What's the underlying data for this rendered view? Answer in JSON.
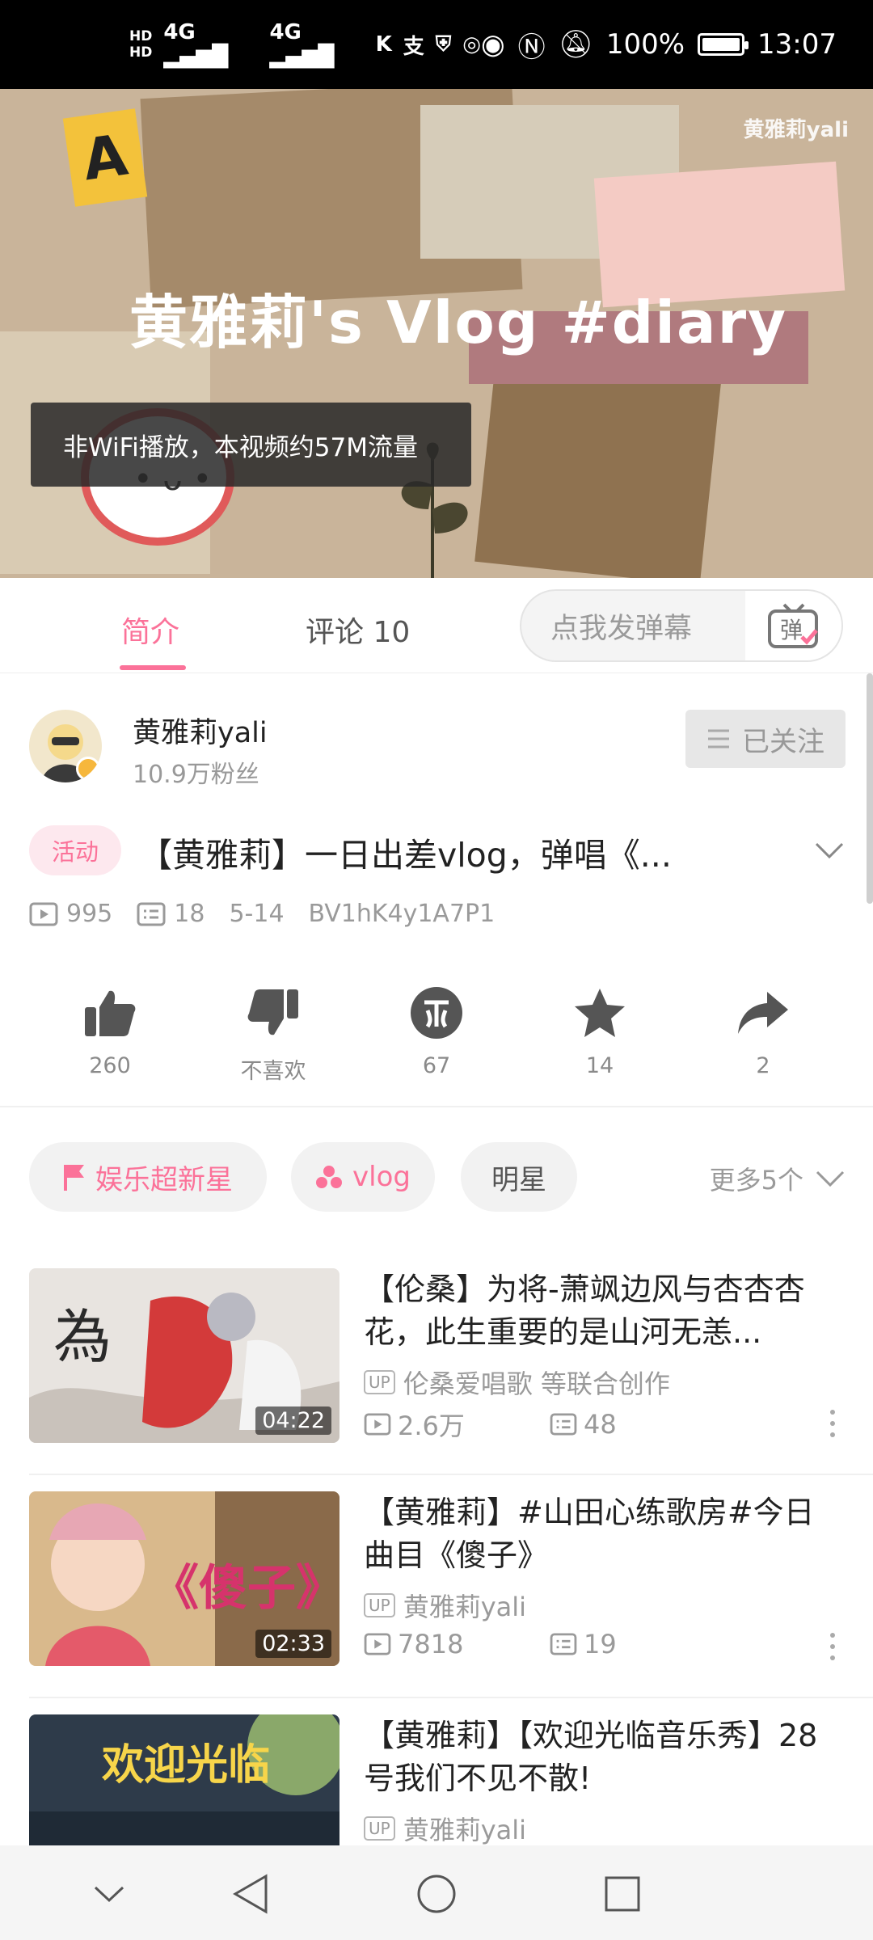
{
  "status_bar": {
    "network": "4G",
    "network2": "4G",
    "battery": "100%",
    "time": "13:07"
  },
  "video": {
    "brand_watermark": "黄雅莉yali",
    "overlay_title": "黄雅莉's Vlog #diary",
    "toast": "非WiFi播放，本视频约57M流量"
  },
  "tabs": {
    "intro": "简介",
    "comments": "评论 10",
    "danmaku_placeholder": "点我发弹幕",
    "danmaku_button": "弹"
  },
  "uploader": {
    "name": "黄雅莉yali",
    "fans": "10.9万粉丝",
    "follow_label": "已关注"
  },
  "video_info": {
    "tag": "活动",
    "title": "【黄雅莉】一日出差vlog，弹唱《...",
    "plays": "995",
    "danmaku_count": "18",
    "date": "5-14",
    "bvid": "BV1hK4y1A7P1"
  },
  "actions": {
    "like": "260",
    "dislike": "不喜欢",
    "coin": "67",
    "favorite": "14",
    "share": "2"
  },
  "tags": {
    "items": [
      "娱乐超新星",
      "vlog",
      "明星"
    ],
    "more": "更多5个"
  },
  "recommendations": [
    {
      "title": "【伦桑】为将-萧飒边风与杏杏杏花，此生重要的是山河无恙...",
      "up": "伦桑爱唱歌 等联合创作",
      "plays": "2.6万",
      "danmaku": "48",
      "duration": "04:22"
    },
    {
      "title": "【黄雅莉】#山田心练歌房#今日曲目《傻子》",
      "up": "黄雅莉yali",
      "plays": "7818",
      "danmaku": "19",
      "duration": "02:33",
      "thumb_text": "《傻子》"
    },
    {
      "title": "【黄雅莉】【欢迎光临音乐秀】28号我们不见不散!",
      "up": "黄雅莉yali",
      "thumb_text": "欢迎光临"
    }
  ],
  "up_badge": "UP",
  "colors": {
    "accent": "#fb7299"
  }
}
